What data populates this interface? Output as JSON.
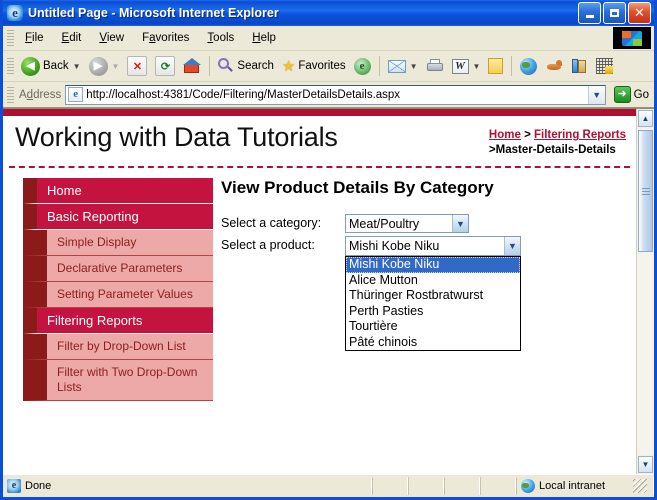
{
  "window": {
    "title": "Untitled Page - Microsoft Internet Explorer",
    "minimize_label": "Minimize",
    "maximize_label": "Maximize",
    "close_label": "Close"
  },
  "menu": [
    {
      "label": "File",
      "accel": "F"
    },
    {
      "label": "Edit",
      "accel": "E"
    },
    {
      "label": "View",
      "accel": "V"
    },
    {
      "label": "Favorites",
      "accel": "a"
    },
    {
      "label": "Tools",
      "accel": "T"
    },
    {
      "label": "Help",
      "accel": "H"
    }
  ],
  "toolbar": {
    "back": "Back",
    "forward": "Forward",
    "stop": "Stop",
    "refresh": "Refresh",
    "home": "Home",
    "search": "Search",
    "favorites": "Favorites",
    "media": "Media",
    "mail": "Mail",
    "print": "Print",
    "edit": "Edit",
    "notes": "Notes",
    "globe": "MSN",
    "fox": "Messenger",
    "research": "Research",
    "encarta": "Encarta"
  },
  "address": {
    "label": "Address",
    "url": "http://localhost:4381/Code/Filtering/MasterDetailsDetails.aspx",
    "go_label": "Go"
  },
  "page": {
    "title": "Working with Data Tutorials",
    "breadcrumb": {
      "home": "Home",
      "sep1": ">",
      "section": "Filtering Reports",
      "sep2": ">",
      "current": "Master-Details-Details"
    },
    "sidebar": [
      {
        "label": "Home",
        "level": "top"
      },
      {
        "label": "Basic Reporting",
        "level": "top"
      },
      {
        "label": "Simple Display",
        "level": "sub"
      },
      {
        "label": "Declarative Parameters",
        "level": "sub"
      },
      {
        "label": "Setting Parameter Values",
        "level": "sub"
      },
      {
        "label": "Filtering Reports",
        "level": "top"
      },
      {
        "label": "Filter by Drop-Down List",
        "level": "sub"
      },
      {
        "label": "Filter with Two Drop-Down Lists",
        "level": "sub"
      }
    ],
    "main": {
      "heading": "View Product Details By Category",
      "category_label": "Select a category:",
      "category_value": "Meat/Poultry",
      "product_label": "Select a product:",
      "product_value": "Mishi Kobe Niku",
      "product_options": [
        "Mishi Kobe Niku",
        "Alice Mutton",
        "Thüringer Rostbratwurst",
        "Perth Pasties",
        "Tourtière",
        "Pâté chinois"
      ],
      "product_selected_index": 0
    }
  },
  "statusbar": {
    "status": "Done",
    "zone": "Local intranet"
  },
  "colors": {
    "accent_red": "#c4133f",
    "dark_red": "#8b1a1a",
    "sub_pink": "#eda8a8",
    "link_red": "#b01030",
    "selection_blue": "#3169c6"
  }
}
